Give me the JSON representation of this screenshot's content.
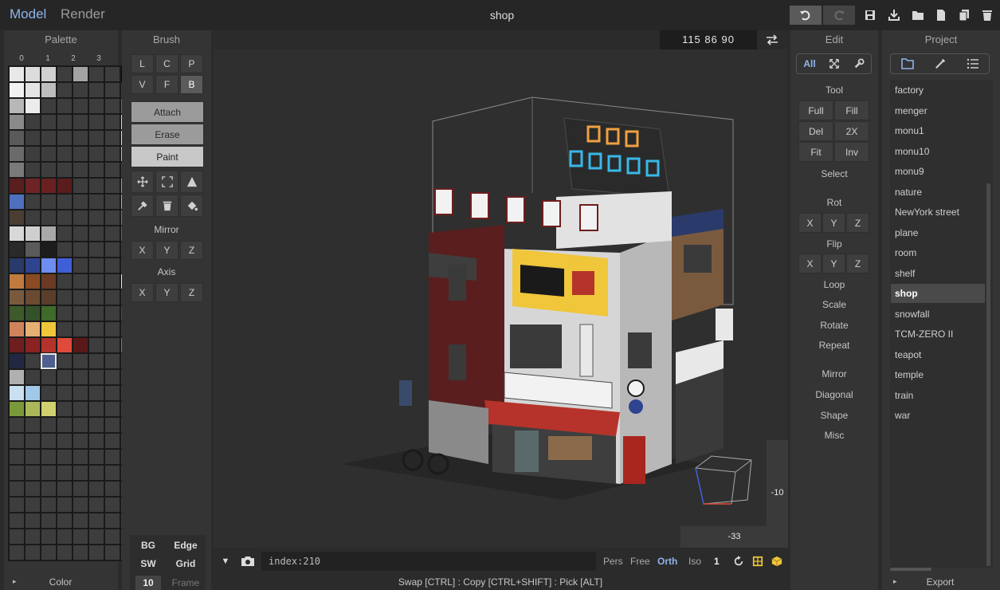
{
  "topbar": {
    "modes": [
      "Model",
      "Render"
    ],
    "title": "shop",
    "icons": [
      "undo-icon",
      "redo-icon",
      "save-icon",
      "import-icon",
      "open-folder-icon",
      "new-file-icon",
      "duplicate-icon",
      "delete-icon"
    ]
  },
  "palette": {
    "title": "Palette",
    "columns": [
      "0",
      "1",
      "2",
      "3"
    ],
    "footer_label": "Color",
    "colors": [
      "#e8e8e8",
      "#dcdcdc",
      "#d0d0d0",
      "#3d3d3d",
      "#a3a3a3",
      "#3d3d3d",
      "#3d3d3d",
      "#0a0a0a",
      "#f2f2f2",
      "#e4e4e4",
      "#bdbdbd",
      "#3d3d3d",
      "#3d3d3d",
      "#3d3d3d",
      "#3d3d3d",
      "#3a3a3a",
      "#b8b8b8",
      "#ececec",
      "#3d3d3d",
      "#3d3d3d",
      "#3d3d3d",
      "#3d3d3d",
      "#3d3d3d",
      "#6b6b6b",
      "#8a8a8a",
      "#3d3d3d",
      "#3d3d3d",
      "#3d3d3d",
      "#3d3d3d",
      "#3d3d3d",
      "#3d3d3d",
      "#f4d37a",
      "#5a5a5a",
      "#3d3d3d",
      "#3d3d3d",
      "#3d3d3d",
      "#3d3d3d",
      "#3d3d3d",
      "#3d3d3d",
      "#f6e59a",
      "#6a6a6a",
      "#3d3d3d",
      "#3d3d3d",
      "#3d3d3d",
      "#3d3d3d",
      "#3d3d3d",
      "#3d3d3d",
      "#e9b25a",
      "#7a7a7a",
      "#3d3d3d",
      "#3d3d3d",
      "#3d3d3d",
      "#3d3d3d",
      "#3d3d3d",
      "#3d3d3d",
      "#3d3d3d",
      "#5a1e1e",
      "#6e2424",
      "#6a2020",
      "#5a1c1c",
      "#3d3d3d",
      "#3d3d3d",
      "#3d3d3d",
      "#ef8a2e",
      "#4f6fbf",
      "#3d3d3d",
      "#3d3d3d",
      "#3d3d3d",
      "#3d3d3d",
      "#3d3d3d",
      "#3d3d3d",
      "#5cc6f2",
      "#4a3d32",
      "#3d3d3d",
      "#3d3d3d",
      "#3d3d3d",
      "#3d3d3d",
      "#3d3d3d",
      "#3d3d3d",
      "#e34e3a",
      "#d8d8d8",
      "#cfcfcf",
      "#a8a8a8",
      "#3d3d3d",
      "#3d3d3d",
      "#3d3d3d",
      "#3d3d3d",
      "#c43b2f",
      "#2a2a2a",
      "#5a5a5a",
      "#1c1c1c",
      "#3d3d3d",
      "#3d3d3d",
      "#3d3d3d",
      "#3d3d3d",
      "#3d3d3d",
      "#2a3a6a",
      "#2f4490",
      "#6f8cf0",
      "#3f5fd8",
      "#3d3d3d",
      "#3d3d3d",
      "#3d3d3d",
      "#3d3d3d",
      "#c07a3e",
      "#8a4a22",
      "#6a3a22",
      "#3d3d3d",
      "#3d3d3d",
      "#3d3d3d",
      "#3d3d3d",
      "#e8e8e8",
      "#7a5a3e",
      "#6a4a30",
      "#5a3e2a",
      "#3d3d3d",
      "#3d3d3d",
      "#3d3d3d",
      "#3d3d3d",
      "#3d3d3d",
      "#3e5a2a",
      "#34522a",
      "#3e6a2a",
      "#3d3d3d",
      "#3d3d3d",
      "#3d3d3d",
      "#3d3d3d",
      "#a8261e",
      "#d0835a",
      "#e5b072",
      "#f0c63a",
      "#3d3d3d",
      "#3d3d3d",
      "#3d3d3d",
      "#3d3d3d",
      "#2c3a6a",
      "#6e1e1e",
      "#8a2222",
      "#b5332a",
      "#e04a3a",
      "#5a1818",
      "#3d3d3d",
      "#3d3d3d",
      "#6676b0",
      "#222842",
      "#3d3d3d",
      "#4f5f8f",
      "#3d3d3d",
      "#3d3d3d",
      "#3d3d3d",
      "#3d3d3d",
      "#3d3d3d",
      "#b0b0b0",
      "#3d3d3d",
      "#3d3d3d",
      "#3d3d3d",
      "#3d3d3d",
      "#3d3d3d",
      "#3d3d3d",
      "#3d3d3d",
      "#c8e0f0",
      "#a0c8e8",
      "#3d3d3d",
      "#3d3d3d",
      "#3d3d3d",
      "#3d3d3d",
      "#3d3d3d",
      "#3d3d3d",
      "#7a9a3a",
      "#aab85a",
      "#d0d070",
      "#3d3d3d",
      "#3d3d3d",
      "#3d3d3d",
      "#3d3d3d",
      "#3d3d3d",
      "#3d3d3d",
      "#3d3d3d",
      "#3d3d3d",
      "#3d3d3d",
      "#3d3d3d",
      "#3d3d3d",
      "#3d3d3d",
      "#3d3d3d",
      "#3d3d3d",
      "#3d3d3d",
      "#3d3d3d",
      "#3d3d3d",
      "#3d3d3d",
      "#3d3d3d",
      "#3d3d3d",
      "#3d3d3d",
      "#3d3d3d",
      "#3d3d3d",
      "#3d3d3d",
      "#3d3d3d",
      "#3d3d3d",
      "#3d3d3d",
      "#3d3d3d",
      "#3d3d3d",
      "#3d3d3d",
      "#3d3d3d",
      "#3d3d3d",
      "#3d3d3d",
      "#3d3d3d",
      "#3d3d3d",
      "#3d3d3d",
      "#3d3d3d",
      "#3d3d3d",
      "#3d3d3d",
      "#3d3d3d",
      "#3d3d3d",
      "#3d3d3d",
      "#3d3d3d",
      "#3d3d3d",
      "#3d3d3d",
      "#3d3d3d",
      "#3d3d3d",
      "#3d3d3d",
      "#3d3d3d",
      "#3d3d3d",
      "#3d3d3d",
      "#3d3d3d",
      "#3d3d3d",
      "#3d3d3d",
      "#3d3d3d",
      "#3d3d3d",
      "#3d3d3d",
      "#3d3d3d",
      "#3d3d3d",
      "#3d3d3d",
      "#3d3d3d",
      "#3d3d3d",
      "#3d3d3d",
      "#3d3d3d",
      "#3d3d3d",
      "#3d3d3d",
      "#3d3d3d",
      "#3d3d3d",
      "#3d3d3d",
      "#3d3d3d",
      "#3d3d3d",
      "#3d3d3d",
      "#3d3d3d",
      "#3d3d3d",
      "#3d3d3d",
      "#3d3d3d",
      "#3d3d3d"
    ]
  },
  "brush": {
    "title": "Brush",
    "shape_row1": [
      "L",
      "C",
      "P"
    ],
    "shape_row2": [
      "V",
      "F",
      "B"
    ],
    "modes": [
      "Attach",
      "Erase",
      "Paint"
    ],
    "mirror_label": "Mirror",
    "axis_label": "Axis",
    "xyz": [
      "X",
      "Y",
      "Z"
    ],
    "bottom": {
      "bg": "BG",
      "edge": "Edge",
      "sw": "SW",
      "grid": "Grid",
      "frame_num": "10",
      "frame": "Frame"
    }
  },
  "viewport": {
    "coords": "115  86  90",
    "index_text": "index:210",
    "proj_modes": [
      "Pers",
      "Free",
      "Orth",
      "Iso"
    ],
    "step": "1",
    "hint": "Swap [CTRL] : Copy [CTRL+SHIFT] : Pick [ALT]",
    "axis_z": "-10",
    "axis_x": "-33"
  },
  "edit": {
    "title": "Edit",
    "tabs": [
      "All"
    ],
    "tool_label": "Tool",
    "tool_buttons": [
      "Full",
      "Fill",
      "Del",
      "2X",
      "Fit",
      "Inv"
    ],
    "select_label": "Select",
    "rot_label": "Rot",
    "flip_label": "Flip",
    "xyz": [
      "X",
      "Y",
      "Z"
    ],
    "actions": [
      "Loop",
      "Scale",
      "Rotate",
      "Repeat",
      "Mirror",
      "Diagonal",
      "Shape",
      "Misc"
    ]
  },
  "project": {
    "title": "Project",
    "items": [
      "factory",
      "menger",
      "monu1",
      "monu10",
      "monu9",
      "nature",
      "NewYork street",
      "plane",
      "room",
      "shelf",
      "shop",
      "snowfall",
      "TCM-ZERO II",
      "teapot",
      "temple",
      "train",
      "war"
    ],
    "selected": "shop",
    "export_label": "Export"
  }
}
